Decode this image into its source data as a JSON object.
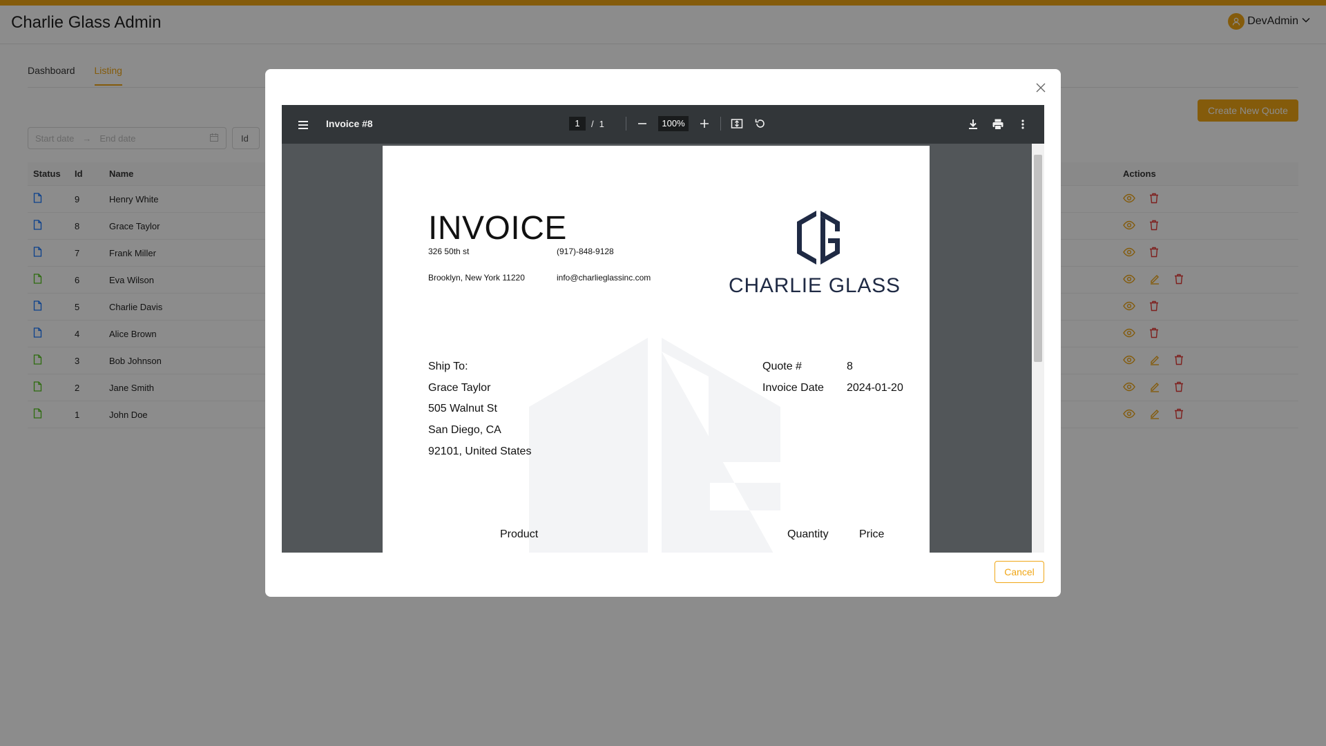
{
  "app": {
    "title": "Charlie Glass Admin",
    "user": "DevAdmin"
  },
  "tabs": [
    {
      "label": "Dashboard",
      "active": false
    },
    {
      "label": "Listing",
      "active": true
    }
  ],
  "toolbar": {
    "create_label": "Create New Quote"
  },
  "filters": {
    "start_placeholder": "Start date",
    "end_placeholder": "End date",
    "id_placeholder": "Id"
  },
  "table": {
    "headers": {
      "status": "Status",
      "id": "Id",
      "name": "Name",
      "actions": "Actions"
    },
    "rows": [
      {
        "id": "9",
        "name": "Henry White",
        "status_color": "#1677ff",
        "editable": false
      },
      {
        "id": "8",
        "name": "Grace Taylor",
        "status_color": "#1677ff",
        "editable": false
      },
      {
        "id": "7",
        "name": "Frank Miller",
        "status_color": "#1677ff",
        "editable": false
      },
      {
        "id": "6",
        "name": "Eva Wilson",
        "status_color": "#52c41a",
        "editable": true
      },
      {
        "id": "5",
        "name": "Charlie Davis",
        "status_color": "#1677ff",
        "editable": false
      },
      {
        "id": "4",
        "name": "Alice Brown",
        "status_color": "#1677ff",
        "editable": false
      },
      {
        "id": "3",
        "name": "Bob Johnson",
        "status_color": "#52c41a",
        "editable": true
      },
      {
        "id": "2",
        "name": "Jane Smith",
        "status_color": "#52c41a",
        "editable": true
      },
      {
        "id": "1",
        "name": "John Doe",
        "status_color": "#52c41a",
        "editable": true
      }
    ]
  },
  "viewer": {
    "doc_title": "Invoice #8",
    "page_current": "1",
    "page_total": "1",
    "zoom": "100%"
  },
  "invoice": {
    "heading": "INVOICE",
    "address1": "326 50th st",
    "phone": "(917)-848-9128",
    "address2": "Brooklyn, New York 11220",
    "email": "info@charlieglassinc.com",
    "logo_text": "CHARLIE GLASS",
    "ship_to_label": "Ship To:",
    "ship_name": "Grace Taylor",
    "ship_street": "505 Walnut St",
    "ship_city": "San Diego, CA",
    "ship_zip": "92101, United States",
    "quote_label": "Quote #",
    "quote_value": "8",
    "date_label": "Invoice Date",
    "date_value": "2024-01-20",
    "col_product": "Product",
    "col_quantity": "Quantity",
    "col_price": "Price"
  },
  "modal": {
    "cancel_label": "Cancel"
  },
  "colors": {
    "accent": "#f0a615",
    "danger": "#e53935",
    "navy": "#1f2a44"
  },
  "icons": [
    "user-icon",
    "chevron-down-icon",
    "calendar-icon",
    "file-icon",
    "eye-icon",
    "edit-icon",
    "trash-icon",
    "close-icon",
    "menu-icon",
    "minus-icon",
    "plus-icon",
    "fit-page-icon",
    "rotate-icon",
    "download-icon",
    "print-icon",
    "more-icon"
  ]
}
